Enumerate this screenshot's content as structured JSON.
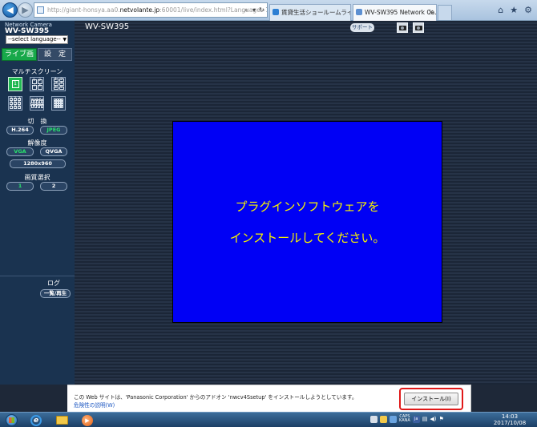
{
  "browser": {
    "url_prefix": "http://",
    "url_domain_a": "giant-honsya.aa0.",
    "url_domain_b": "netvolante.jp",
    "url_rest": ":60001/live/index.html?Language=1/",
    "tabs": [
      {
        "label": "賃貸生活ショールームライブ..."
      },
      {
        "label": "WV-SW395 Network Ca..."
      }
    ]
  },
  "left_panel": {
    "brand_top": "Network Camera",
    "brand_model": "WV-SW395",
    "language_select": "--select language--",
    "mode_live": "ライブ画",
    "mode_setup": "設　定",
    "multiscreen_label": "マルチスクリーン",
    "multiscreen_4": [
      "1",
      "2",
      "3",
      "4"
    ],
    "multiscreen_6": [
      "1",
      "2",
      "3",
      "4",
      "5",
      "6"
    ],
    "multiscreen_9": [
      "1",
      "2",
      "3",
      "4",
      "5",
      "6",
      "7",
      "8",
      "9"
    ],
    "multiscreen_13": [
      "9",
      "10",
      "11",
      "12",
      "13",
      "14",
      "15",
      "16"
    ],
    "multiscreen_16": [
      "1",
      "2",
      "3",
      "4",
      "5",
      "6",
      "7",
      "8",
      "9",
      "10",
      "11",
      "12",
      "13",
      "14",
      "15",
      "16"
    ],
    "switch_label": "切　換",
    "switch_options": [
      "H.264",
      "JPEG"
    ],
    "resolution_label": "解像度",
    "resolution_options": [
      "VGA",
      "QVGA"
    ],
    "resolution_hd": "1280x960",
    "quality_label": "画質選択",
    "quality_options": [
      "1",
      "2"
    ],
    "log_label": "ログ",
    "log_button": "一覧/再生"
  },
  "main": {
    "camera_title": "WV-SW395",
    "support_button": "サポート",
    "plugin_line1": "プラグインソフトウェアを",
    "plugin_line2": "インストールしてください。"
  },
  "infobar": {
    "message": "この Web サイトは、'Panasonic Corporation' からのアドオン 'nwcv4Ssetup' をインストールしようとしています。",
    "risk_link": "危険性の説明(W)",
    "install_button": "インストール(I)"
  },
  "taskbar": {
    "ime_top": "CAPS",
    "ime_bottom": "KANA",
    "ime_badge": "ja",
    "time": "14:03",
    "date": "2017/10/08"
  },
  "colors": {
    "video_bg": "#0000f5",
    "plugin_text": "#f6f200",
    "active_green": "#17a84a",
    "panel_bg": "#1a3350"
  }
}
